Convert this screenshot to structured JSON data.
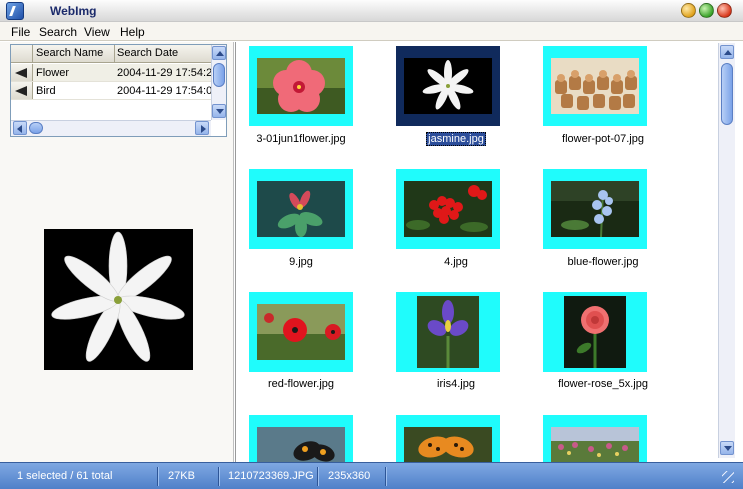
{
  "window": {
    "title": "WebImg"
  },
  "menu": [
    "File",
    "Search",
    "View",
    "Help"
  ],
  "search_table": {
    "headers": [
      "Search Name",
      "Search Date"
    ],
    "rows": [
      {
        "name": "Flower",
        "date": "2004-11-29 17:54:2"
      },
      {
        "name": "Bird",
        "date": "2004-11-29 17:54:0"
      }
    ]
  },
  "thumbnails": [
    {
      "caption": "3-01jun1flower.jpg"
    },
    {
      "caption": "jasmine.jpg",
      "selected": true
    },
    {
      "caption": "flower-pot-07.jpg"
    },
    {
      "caption": "9.jpg"
    },
    {
      "caption": "4.jpg"
    },
    {
      "caption": "blue-flower.jpg"
    },
    {
      "caption": "red-flower.jpg"
    },
    {
      "caption": "iris4.jpg"
    },
    {
      "caption": "flower-rose_5x.jpg"
    }
  ],
  "status": {
    "selection": "1 selected / 61 total",
    "size": "27KB",
    "filename": "1210723369.JPG",
    "dimensions": "235x360"
  },
  "colors": {
    "thumb_frame": "#1ffcfc",
    "thumb_selected": "#102a5c",
    "status_bar": "#4f80c9"
  }
}
